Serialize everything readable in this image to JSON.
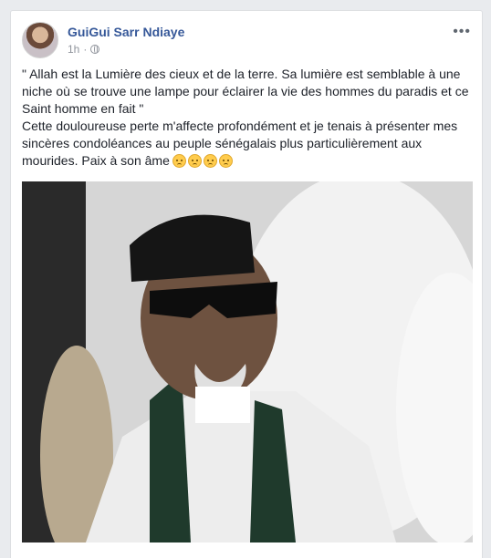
{
  "post": {
    "author": "GuiGui Sarr Ndiaye",
    "timestamp": "1h",
    "privacy_icon": "globe-icon",
    "more_icon": "more-options-icon",
    "text_line1": "\" Allah est la Lumière des cieux et de la terre. Sa lumière est semblable à une niche où se trouve une lampe pour éclairer la vie des hommes du paradis et ce Saint homme en fait \"",
    "text_line2": "Cette douloureuse perte m'affecte profondément et je tenais à présenter mes sincères condoléances au peuple sénégalais plus particulièrement aux mourides. Paix à son âme",
    "emojis": [
      "crying-face-icon",
      "crying-face-icon",
      "crying-face-icon",
      "crying-face-icon"
    ],
    "photo_icon": "photo-image"
  },
  "colors": {
    "author": "#365899",
    "meta": "#90949c",
    "text": "#1d2129",
    "background": "#e9ebee"
  }
}
